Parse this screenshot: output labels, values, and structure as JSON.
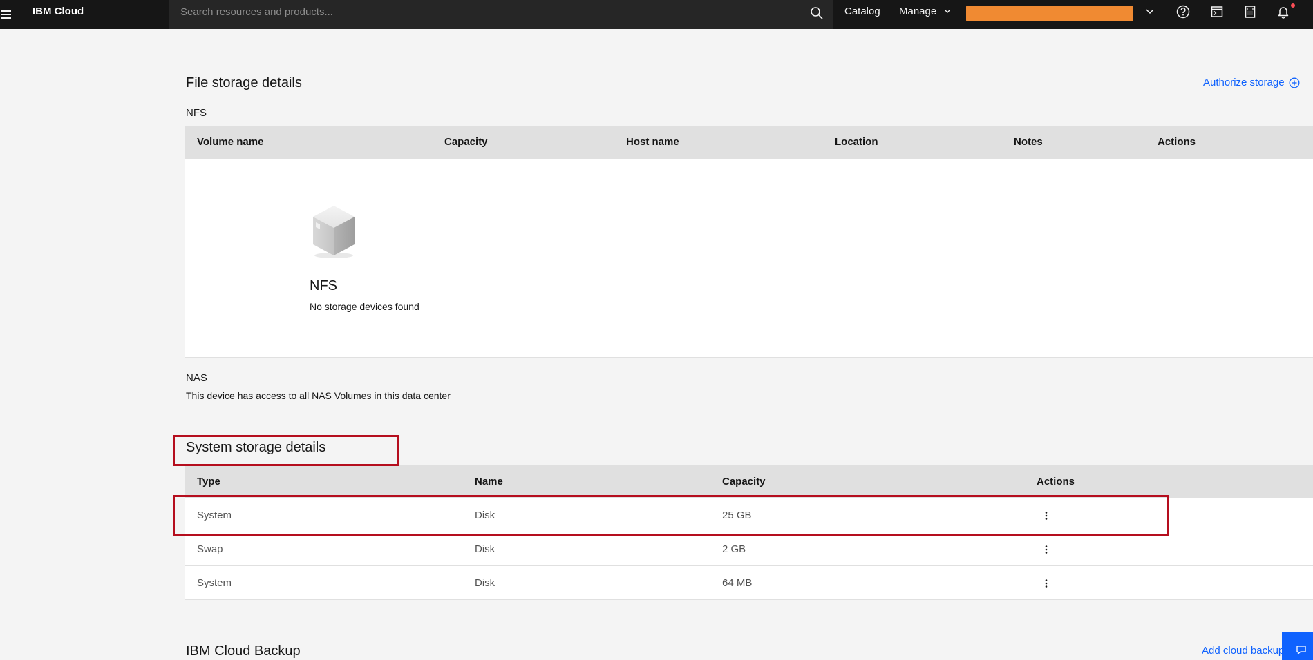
{
  "header": {
    "brand": "IBM Cloud",
    "search_placeholder": "Search resources and products...",
    "catalog_label": "Catalog",
    "manage_label": "Manage"
  },
  "file_storage": {
    "title": "File storage details",
    "authorize_label": "Authorize storage",
    "nfs_label": "NFS",
    "columns": [
      "Volume name",
      "Capacity",
      "Host name",
      "Location",
      "Notes",
      "Actions"
    ],
    "empty_title": "NFS",
    "empty_desc": "No storage devices found",
    "nas_label": "NAS",
    "nas_desc": "This device has access to all NAS Volumes in this data center"
  },
  "system_storage": {
    "title": "System storage details",
    "columns": [
      "Type",
      "Name",
      "Capacity",
      "Actions"
    ],
    "rows": [
      {
        "type": "System",
        "name": "Disk",
        "capacity": "25 GB"
      },
      {
        "type": "Swap",
        "name": "Disk",
        "capacity": "2 GB"
      },
      {
        "type": "System",
        "name": "Disk",
        "capacity": "64 MB"
      }
    ]
  },
  "backup": {
    "title": "IBM Cloud Backup",
    "add_label": "Add cloud backup"
  },
  "colors": {
    "accent": "#0f62fe",
    "highlight": "#b50e1e",
    "account_badge": "#f08a32"
  }
}
